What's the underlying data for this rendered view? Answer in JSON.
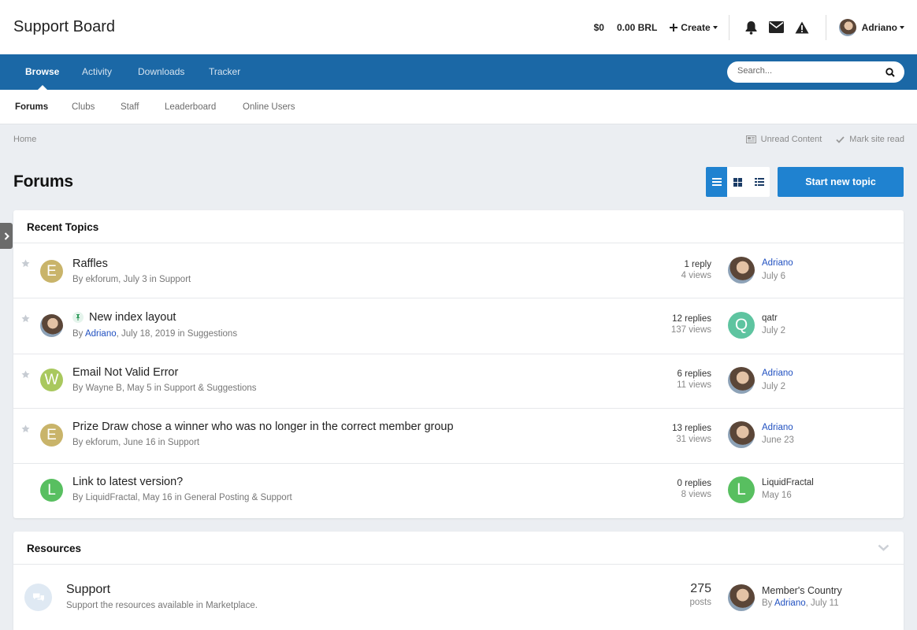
{
  "header": {
    "site_title": "Support Board",
    "balance": "$0",
    "currency": "0.00 BRL",
    "create_label": "Create",
    "username": "Adriano"
  },
  "nav": {
    "tabs": [
      "Browse",
      "Activity",
      "Downloads",
      "Tracker"
    ],
    "active": "Browse",
    "search_placeholder": "Search..."
  },
  "subnav": {
    "tabs": [
      "Forums",
      "Clubs",
      "Staff",
      "Leaderboard",
      "Online Users"
    ],
    "active": "Forums"
  },
  "breadcrumb": {
    "home": "Home",
    "unread": "Unread Content",
    "mark_read": "Mark site read"
  },
  "page": {
    "title": "Forums",
    "start_topic": "Start new topic"
  },
  "recent": {
    "title": "Recent Topics",
    "topics": [
      {
        "title": "Raffles",
        "avatar_letter": "E",
        "by": "By ",
        "author": "ekforum",
        "date": ", July 3 in ",
        "forum": "Support",
        "replies": "1 reply",
        "views": "4 views",
        "last_user": "Adriano",
        "last_date": "July 6"
      },
      {
        "title": "New index layout",
        "avatar_letter": "",
        "by": "By ",
        "author": "Adriano",
        "date": ", July 18, 2019 in ",
        "forum": "Suggestions",
        "replies": "12 replies",
        "views": "137 views",
        "last_user": "qatr",
        "last_letter": "Q",
        "last_date": "July 2"
      },
      {
        "title": "Email Not Valid Error",
        "avatar_letter": "W",
        "by": "By ",
        "author": "Wayne B",
        "date": ", May 5 in ",
        "forum": "Support & Suggestions",
        "replies": "6 replies",
        "views": "11 views",
        "last_user": "Adriano",
        "last_date": "July 2"
      },
      {
        "title": "Prize Draw chose a winner who was no longer in the correct member group",
        "avatar_letter": "E",
        "by": "By ",
        "author": "ekforum",
        "date": ", June 16 in ",
        "forum": "Support",
        "replies": "13 replies",
        "views": "31 views",
        "last_user": "Adriano",
        "last_date": "June 23"
      },
      {
        "title": "Link to latest version?",
        "avatar_letter": "L",
        "by": "By ",
        "author": "LiquidFractal",
        "date": ", May 16 in ",
        "forum": "General Posting & Support",
        "replies": "0 replies",
        "views": "8 views",
        "last_user": "LiquidFractal",
        "last_letter": "L",
        "last_date": "May 16"
      }
    ]
  },
  "resources": {
    "title": "Resources",
    "item": {
      "name": "Support",
      "description": "Support the resources available in Marketplace.",
      "count": "275",
      "count_label": "posts",
      "last_title": "Member's Country",
      "last_by": "By ",
      "last_user": "Adriano",
      "last_date": ", July 11"
    }
  },
  "colors": {
    "nav_bg": "#1b68a6",
    "primary": "#1f82d0",
    "avatar_e": "#c9b46a",
    "avatar_w": "#a9c85e",
    "avatar_q": "#5ec4a0",
    "avatar_l": "#58bf60",
    "link": "#2050c0"
  }
}
